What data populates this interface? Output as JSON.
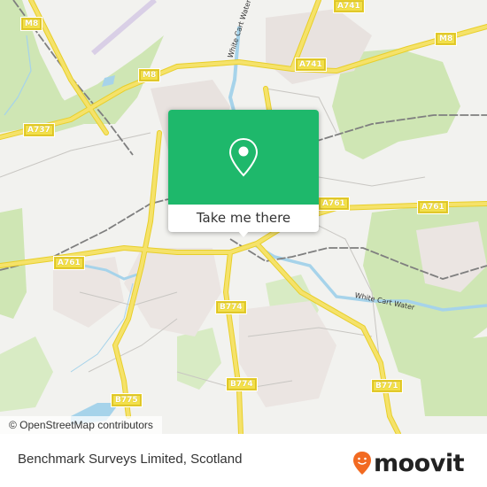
{
  "map": {
    "road_labels": [
      {
        "id": "m8-nw",
        "text": "M8"
      },
      {
        "id": "m8-center",
        "text": "M8"
      },
      {
        "id": "m8-ne",
        "text": "M8"
      },
      {
        "id": "a741-top",
        "text": "A741"
      },
      {
        "id": "a741-mid",
        "text": "A741"
      },
      {
        "id": "a737",
        "text": "A737"
      },
      {
        "id": "a761-west",
        "text": "A761"
      },
      {
        "id": "a761-center",
        "text": "A761"
      },
      {
        "id": "a761-east",
        "text": "A761"
      },
      {
        "id": "b774-north",
        "text": "B774"
      },
      {
        "id": "b774-south",
        "text": "B774"
      },
      {
        "id": "b775",
        "text": "B775"
      },
      {
        "id": "b771",
        "text": "B771"
      }
    ],
    "water_labels": [
      {
        "id": "white-cart-north",
        "text": "White Cart Water"
      },
      {
        "id": "white-cart-east",
        "text": "White Cart Water"
      }
    ],
    "colors": {
      "background": "#f2f2ef",
      "park": "#cfe6b4",
      "urban": "#e8e2df",
      "water": "#a6d3ea",
      "road": "#f5e26a",
      "rail": "#808080"
    }
  },
  "popup": {
    "icon": "map-pin-icon",
    "button_label": "Take me there",
    "color": "#1eb86b"
  },
  "attribution": "© OpenStreetMap contributors",
  "footer": {
    "place_title": "Benchmark Surveys Limited, Scotland",
    "logo_text": "moovit",
    "logo_color": "#f26a21"
  }
}
